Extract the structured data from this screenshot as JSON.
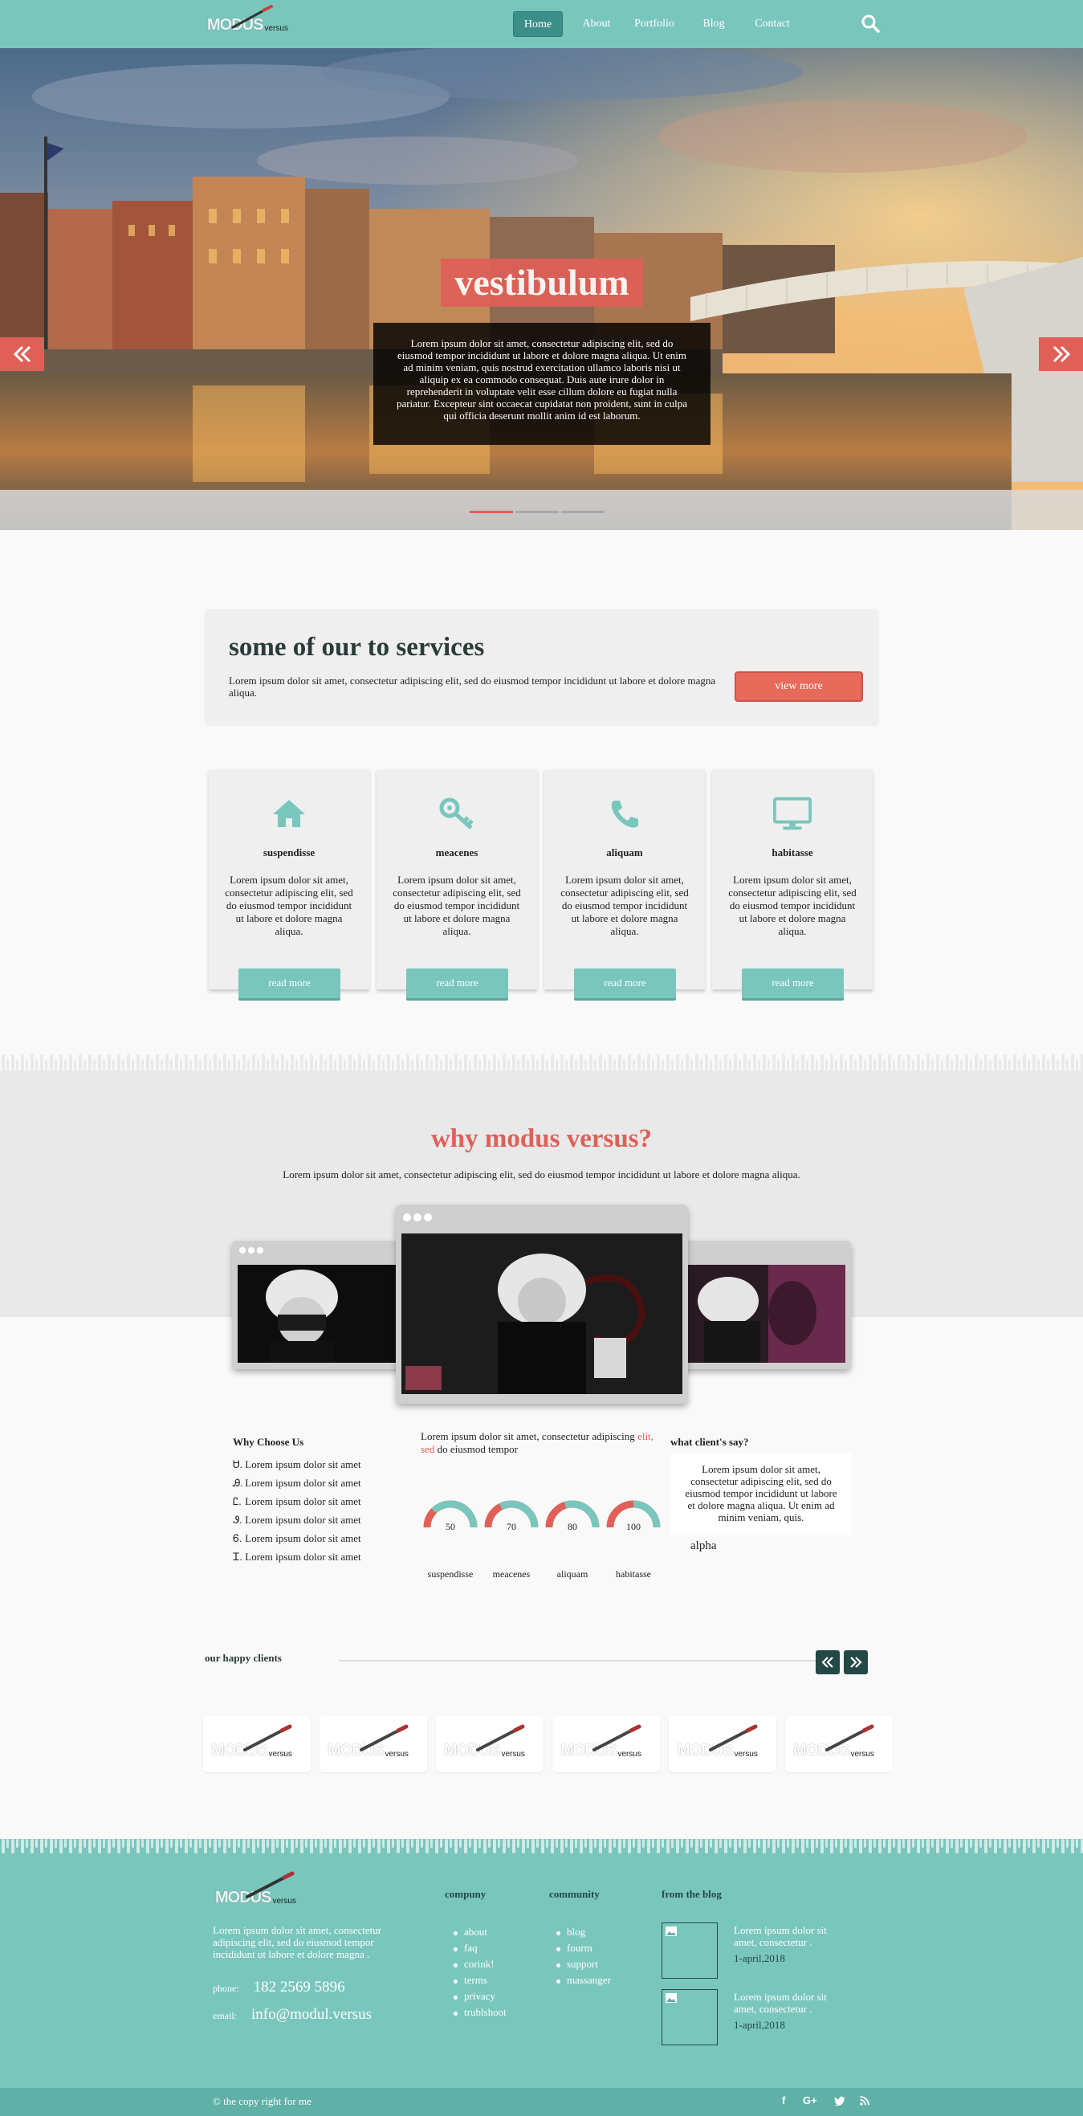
{
  "nav": {
    "logo_main": "MODUS",
    "logo_sub": "versus",
    "items": [
      "Home",
      "About",
      "Portfolio",
      "Blog",
      "Contact"
    ],
    "active": "Home"
  },
  "hero": {
    "title": "vestibulum",
    "text": "Lorem ipsum dolor sit amet, consectetur adipiscing elit, sed do eiusmod tempor incididunt ut labore et dolore magna aliqua. Ut enim ad minim veniam, quis nostrud exercitation ullamco laboris nisi ut aliquip ex ea commodo consequat. Duis aute irure dolor in reprehenderit in voluptate velit esse cillum dolore eu fugiat nulla pariatur. Excepteur sint occaecat cupidatat non proident, sunt in culpa qui officia deserunt mollit anim id est laborum."
  },
  "services": {
    "title": "some of our to services",
    "subtitle": "Lorem ipsum dolor sit amet, consectetur adipiscing elit, sed do eiusmod tempor incididunt ut labore et dolore magna aliqua.",
    "view_more": "view more",
    "cards": [
      {
        "icon": "home-icon",
        "title": "suspendisse",
        "body": "Lorem ipsum dolor sit amet, consectetur adipiscing elit, sed do eiusmod tempor incididunt ut labore et dolore magna aliqua.",
        "button": "read more"
      },
      {
        "icon": "key-icon",
        "title": "meacenes",
        "body": "Lorem ipsum dolor sit amet, consectetur adipiscing elit, sed do eiusmod tempor incididunt ut labore et dolore magna aliqua.",
        "button": "read more"
      },
      {
        "icon": "phone-icon",
        "title": "aliquam",
        "body": "Lorem ipsum dolor sit amet, consectetur adipiscing elit, sed do eiusmod tempor incididunt ut labore et dolore magna aliqua.",
        "button": "read more"
      },
      {
        "icon": "monitor-icon",
        "title": "habitasse",
        "body": "Lorem ipsum dolor sit amet, consectetur adipiscing elit, sed do eiusmod tempor incididunt ut labore et dolore magna aliqua.",
        "button": "read more"
      }
    ]
  },
  "why": {
    "title": "why modus versus?",
    "subtitle": "Lorem ipsum dolor sit amet, consectetur adipiscing elit, sed do eiusmod tempor incididunt ut labore et dolore magna aliqua.",
    "choose_head": "Why Choose Us",
    "choose_items": [
      {
        "bullet": "Ꮜ.",
        "text": "Lorem ipsum dolor sit amet"
      },
      {
        "bullet": "Ꭿ.",
        "text": "Lorem ipsum dolor sit amet"
      },
      {
        "bullet": "Ꮭ.",
        "text": "Lorem ipsum dolor sit amet"
      },
      {
        "bullet": "Ꮽ.",
        "text": "Lorem ipsum dolor sit amet"
      },
      {
        "bullet": "Ꮾ.",
        "text": "Lorem ipsum dolor sit amet"
      },
      {
        "bullet": "Ꮖ.",
        "text": "Lorem ipsum dolor sit amet"
      }
    ],
    "mid_text_a": "Lorem ipsum dolor sit amet, consectetur adipiscing",
    "mid_text_red": "elit, sed",
    "mid_text_b": "do eiusmod tempor",
    "gauges": [
      {
        "value": 50,
        "label": "suspendisse"
      },
      {
        "value": 70,
        "label": "meacenes"
      },
      {
        "value": 80,
        "label": "aliquam"
      },
      {
        "value": 100,
        "label": "habitasse"
      }
    ],
    "client_head": "what client's say?",
    "client_quote": "Lorem ipsum dolor sit amet, consectetur adipiscing elit, sed do eiusmod tempor incididunt ut labore et dolore magna aliqua. Ut enim ad minim veniam, quis.",
    "client_name": "alpha"
  },
  "clients": {
    "title": "our happy clients",
    "logo_main": "MODUS",
    "logo_sub": "versus"
  },
  "footer": {
    "logo_main": "MODUS",
    "logo_sub": "versus",
    "about": "Lorem ipsum dolor sit amet, consectetur adipiscing elit, sed do eiusmod tempor incididunt ut labore et dolore magna .",
    "phone_label": "phone:",
    "phone": "182 2569 5896",
    "email_label": "email:",
    "email": "info@modul.versus",
    "company_head": "compuny",
    "company_links": [
      "about",
      "faq",
      "corink!",
      "terms",
      "privacy",
      "trublshoot"
    ],
    "community_head": "community",
    "community_links": [
      "blog",
      "fourm",
      "support",
      "massanger"
    ],
    "blog_head": "from the blog",
    "blog": [
      {
        "title": "Lorem ipsum dolor sit amet, consectetur .",
        "date": "1-april,2018"
      },
      {
        "title": "Lorem ipsum dolor sit amet, consectetur .",
        "date": "1-april,2018"
      }
    ],
    "copyright": "© the copy right for me",
    "social": [
      "f",
      "G+",
      "twitter-icon",
      "rss-icon"
    ]
  },
  "colors": {
    "teal": "#79c6bd",
    "coral": "#e06058",
    "dark": "#234846"
  }
}
